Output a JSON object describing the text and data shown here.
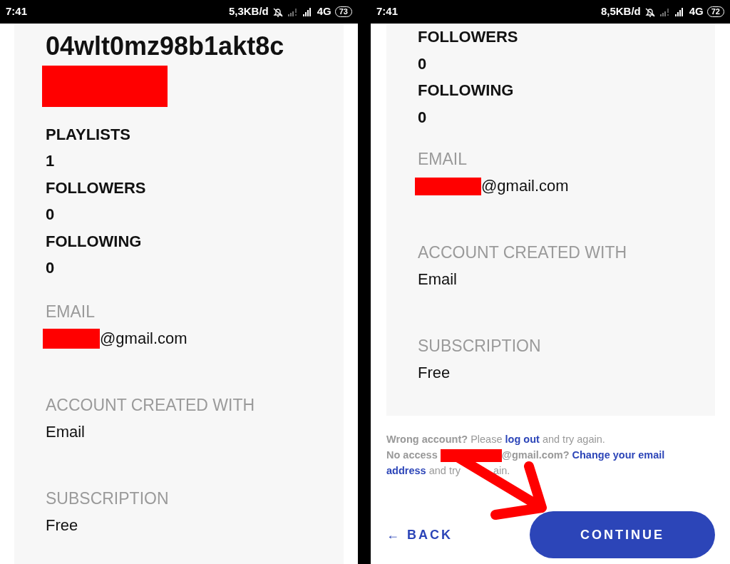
{
  "screens": [
    {
      "status_bar": {
        "time": "7:41",
        "speed": "5,3KB/d",
        "network": "4G",
        "battery": "73"
      },
      "username": "04wlt0mz98b1akt8c",
      "username_redacted": true,
      "stats": [
        {
          "label": "PLAYLISTS",
          "value": "1"
        },
        {
          "label": "FOLLOWERS",
          "value": "0"
        },
        {
          "label": "FOLLOWING",
          "value": "0"
        }
      ],
      "fields": [
        {
          "label": "EMAIL",
          "value": "@gmail.com",
          "redacted": true
        },
        {
          "label": "ACCOUNT CREATED WITH",
          "value": "Email"
        },
        {
          "label": "SUBSCRIPTION",
          "value": "Free"
        }
      ]
    },
    {
      "status_bar": {
        "time": "7:41",
        "speed": "8,5KB/d",
        "network": "4G",
        "battery": "72"
      },
      "stats": [
        {
          "label": "FOLLOWERS",
          "value": "0"
        },
        {
          "label": "FOLLOWING",
          "value": "0"
        }
      ],
      "fields": [
        {
          "label": "EMAIL",
          "value": "@gmail.com",
          "redacted": true
        },
        {
          "label": "ACCOUNT CREATED WITH",
          "value": "Email"
        },
        {
          "label": "SUBSCRIPTION",
          "value": "Free"
        }
      ],
      "footer": [
        [
          {
            "kind": "bold",
            "text": "Wrong account?"
          },
          {
            "kind": "plain",
            "text": "Please"
          },
          {
            "kind": "link",
            "text": "log out"
          },
          {
            "kind": "plain",
            "text": "and try again."
          }
        ],
        [
          {
            "kind": "bold",
            "text": "No access"
          },
          {
            "kind": "redaction"
          },
          {
            "kind": "bold",
            "text": "@gmail.com?",
            "attached": true
          },
          {
            "kind": "link",
            "text": "Change your email"
          },
          {
            "kind": "link",
            "text": "address"
          },
          {
            "kind": "plain",
            "text": "and try"
          },
          {
            "kind": "plain",
            "text": "ain.",
            "covered_gap": true
          }
        ]
      ],
      "back_button": "← BACK",
      "continue_button": "CONTINUE",
      "annotation_arrow": true
    }
  ]
}
